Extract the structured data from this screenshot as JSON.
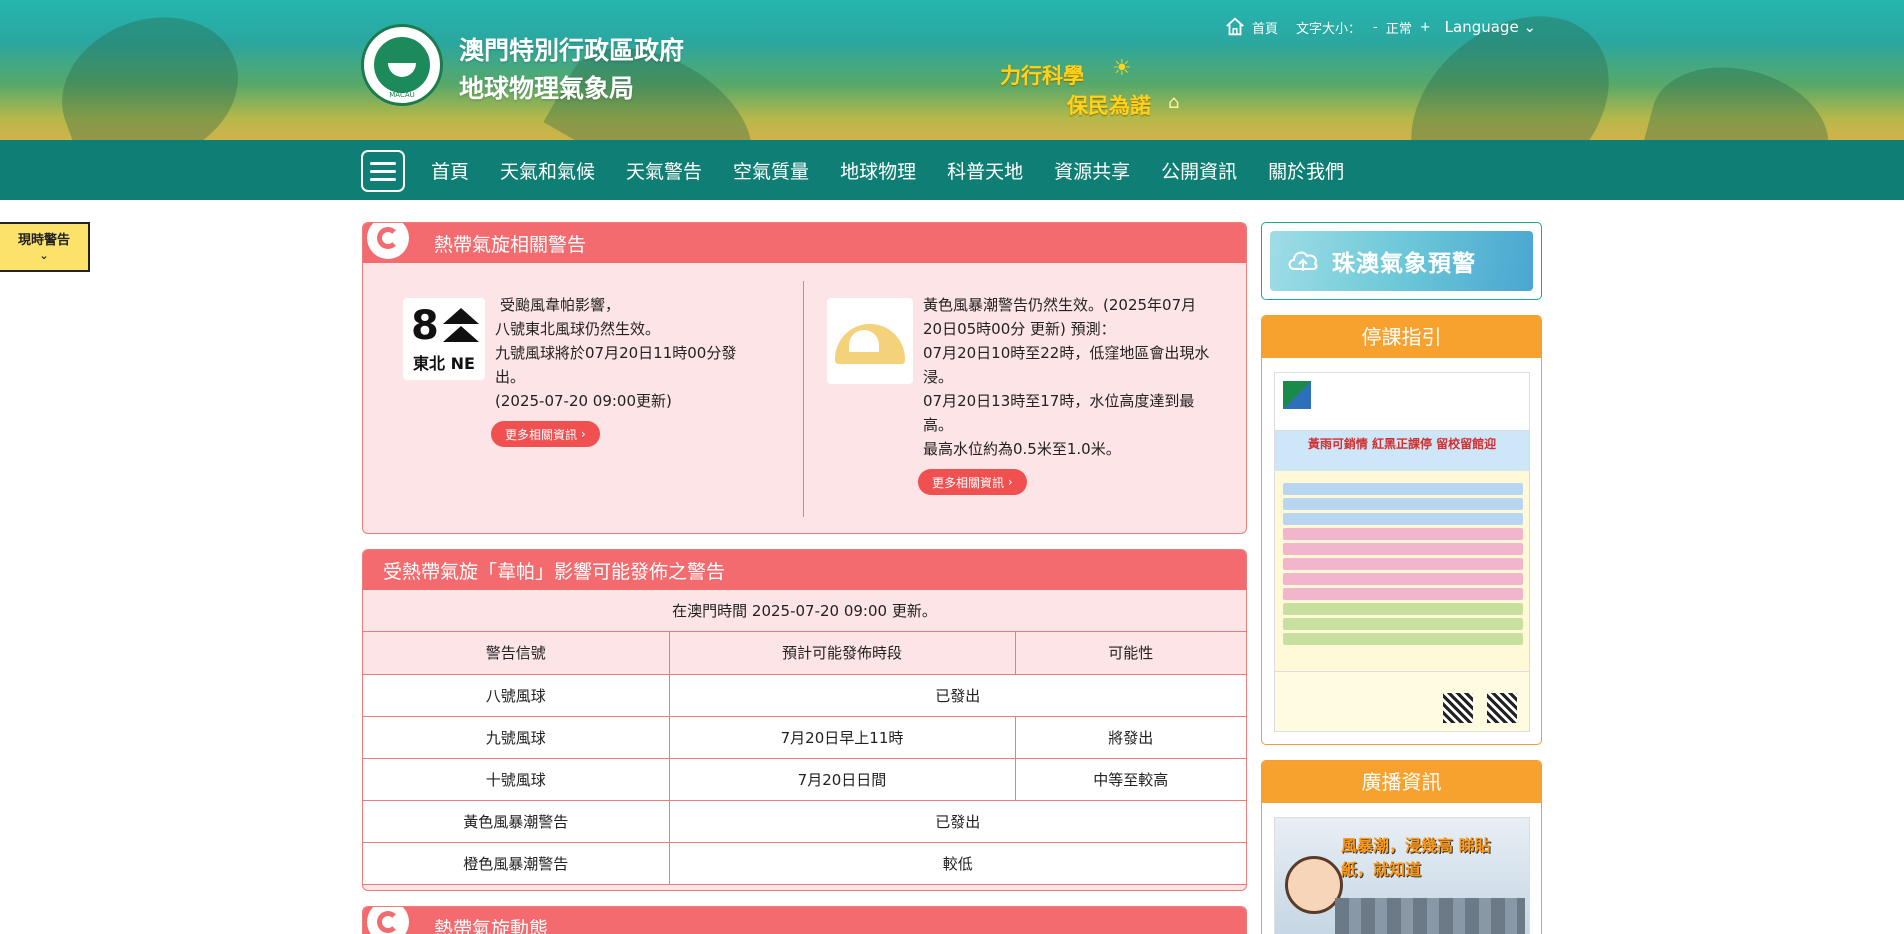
{
  "header": {
    "org_name_line1": "澳門特別行政區政府",
    "org_name_line2": "地球物理氣象局",
    "logo_caption": "MACAU",
    "slogan_line1": "力行科學",
    "slogan_line2": "保民為諾",
    "top_links": {
      "home": "首頁",
      "font_size_label": "文字大小：",
      "font_decrease": "-",
      "font_normal": "正常",
      "font_increase": "+",
      "language": "Language"
    }
  },
  "nav": {
    "items": [
      "首頁",
      "天氣和氣候",
      "天氣警告",
      "空氣質量",
      "地球物理",
      "科普天地",
      "資源共享",
      "公開資訊",
      "關於我們"
    ]
  },
  "current_warning_tab": {
    "label": "現時警告",
    "chevron": "⌄"
  },
  "tc_warning_panel": {
    "title": "熱帶氣旋相關警告",
    "signal": {
      "number": "8",
      "direction": "東北 NE",
      "lines": [
        "受颱風韋帕影響，",
        "八號東北風球仍然生效。",
        "九號風球將於07月20日11時00分發出。",
        "(2025-07-20 09:00更新)"
      ],
      "more_label": "更多相關資訊"
    },
    "storm_surge": {
      "lines": [
        "黃色風暴潮警告仍然生效。(2025年07月20日05時00分 更新) 預測：",
        "07月20日10時至22時，低窪地區會出現水浸。",
        "07月20日13時至17時，水位高度達到最高。",
        "最高水位約為0.5米至1.0米。"
      ],
      "more_label": "更多相關資訊"
    }
  },
  "forecast_panel": {
    "title": "受熱帶氣旋「韋帕」影響可能發佈之警告",
    "update_text": "在澳門時間 2025-07-20 09:00 更新。",
    "columns": [
      "警告信號",
      "預計可能發佈時段",
      "可能性"
    ],
    "rows": [
      {
        "signal": "八號風球",
        "period": "已發出",
        "likelihood": ""
      },
      {
        "signal": "九號風球",
        "period": "7月20日早上11時",
        "likelihood": "將發出"
      },
      {
        "signal": "十號風球",
        "period": "7月20日日間",
        "likelihood": "中等至較高"
      },
      {
        "signal": "黃色風暴潮警告",
        "period": "已發出",
        "likelihood": ""
      },
      {
        "signal": "橙色風暴潮警告",
        "period": "較低",
        "likelihood": ""
      }
    ]
  },
  "tc_dynamics_panel": {
    "title": "熱帶氣旋動態"
  },
  "sidebar": {
    "zhuhai_macau_banner": "珠澳氣象預警",
    "class_suspension": {
      "title": "停課指引",
      "poster_heading": "黃雨可銷情 紅黑正課停 留校留館迎"
    },
    "broadcast": {
      "title": "廣播資訊",
      "poster_heading": "風暴潮，浸幾高 睇貼紙，就知道"
    }
  },
  "colors": {
    "nav_bg": "#0f7e74",
    "panel_head": "#f36b6e",
    "panel_bg": "#fde4e6",
    "side_head": "#f7a12e",
    "warn_tab": "#fbe26a"
  }
}
